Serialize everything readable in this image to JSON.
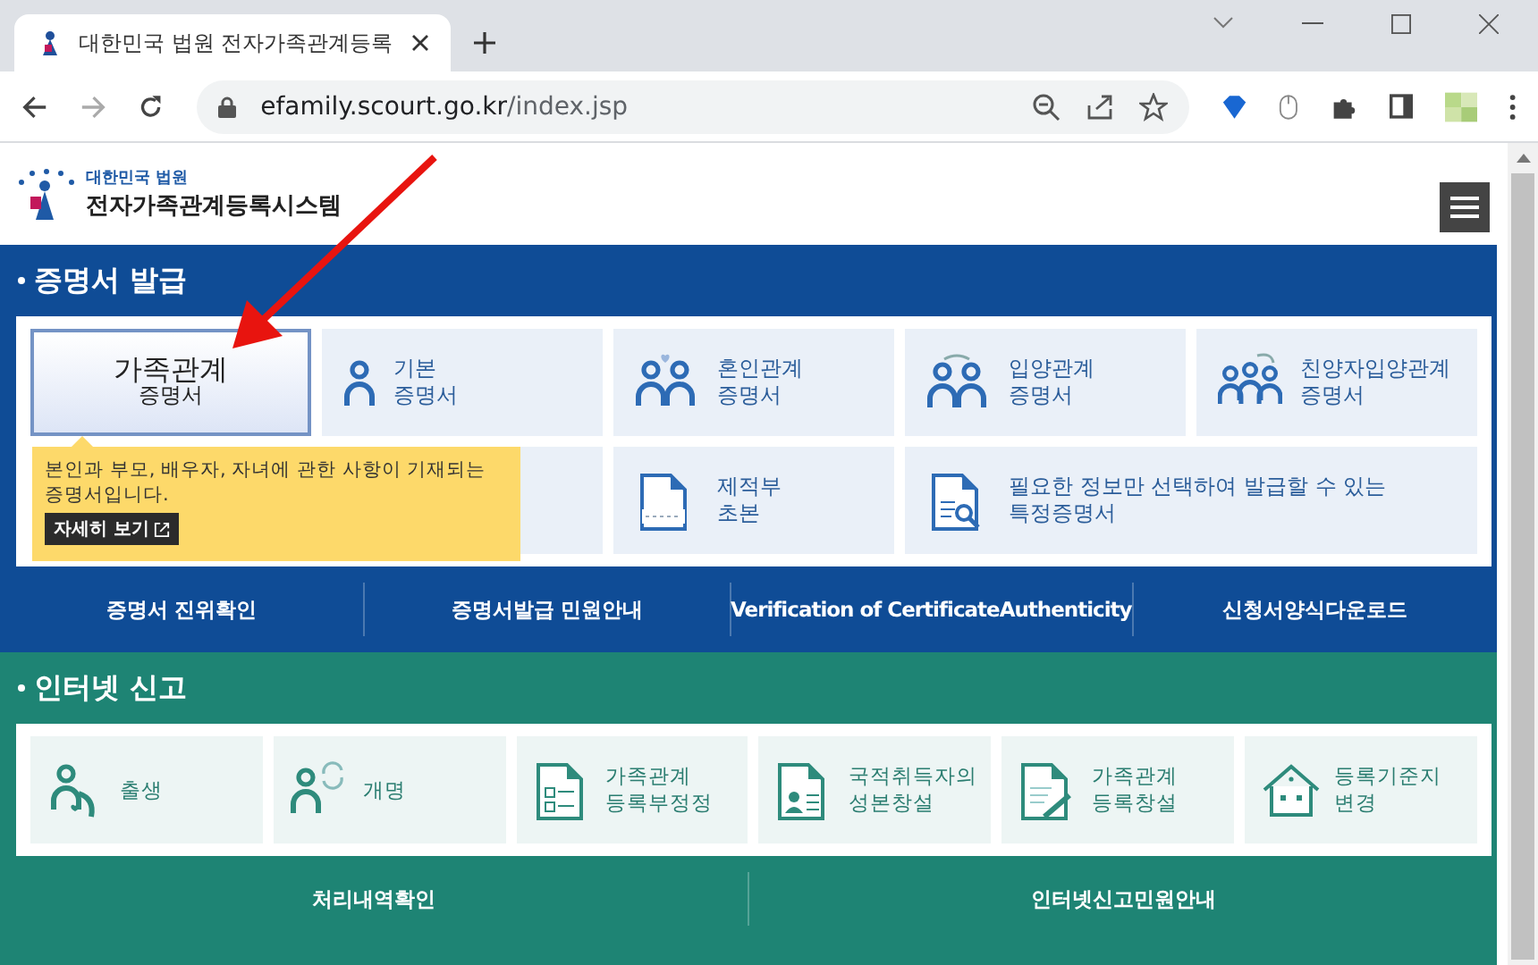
{
  "browser": {
    "tab_title": "대한민국 법원 전자가족관계등록",
    "url_host": "efamily.scourt.go.kr",
    "url_path": "/index.jsp"
  },
  "header": {
    "org": "대한민국 법원",
    "system": "전자가족관계등록시스템"
  },
  "certificates": {
    "title": "증명서 발급",
    "tiles": [
      {
        "kind": "text",
        "lines": [
          "가족관계",
          "증명서"
        ],
        "selected": true
      },
      {
        "kind": "icon",
        "lines": [
          "기본",
          "증명서"
        ],
        "selected": false
      },
      {
        "kind": "icon",
        "lines": [
          "혼인관계",
          "증명서"
        ],
        "selected": false
      },
      {
        "kind": "icon",
        "lines": [
          "입양관계",
          "증명서"
        ],
        "selected": false
      },
      {
        "kind": "icon",
        "lines": [
          "친양자입양관계",
          "증명서"
        ],
        "selected": false
      },
      {
        "kind": "blank",
        "selected": false
      },
      {
        "kind": "icon",
        "lines": [
          "제적부",
          "초본"
        ],
        "selected": false
      },
      {
        "kind": "wide",
        "lines": [
          "필요한 정보만 선택하여 발급할 수 있는",
          "특정증명서"
        ],
        "selected": false
      }
    ],
    "tooltip": {
      "text": "본인과 부모, 배우자, 자녀에 관한 사항이 기재되는 증명서입니다.",
      "button": "자세히 보기"
    },
    "links": [
      "증명서 진위확인",
      "증명서발급 민원안내",
      "Verification of CertificateAuthenticity",
      "신청서양식다운로드"
    ]
  },
  "reports": {
    "title": "인터넷 신고",
    "tiles": [
      {
        "lines": [
          "출생"
        ]
      },
      {
        "lines": [
          "개명"
        ]
      },
      {
        "lines": [
          "가족관계",
          "등록부정정"
        ]
      },
      {
        "lines": [
          "국적취득자의",
          "성본창설"
        ]
      },
      {
        "lines": [
          "가족관계",
          "등록창설"
        ]
      },
      {
        "lines": [
          "등록기준지",
          "변경"
        ]
      }
    ],
    "links": [
      "처리내역확인",
      "인터넷신고민원안내"
    ]
  }
}
